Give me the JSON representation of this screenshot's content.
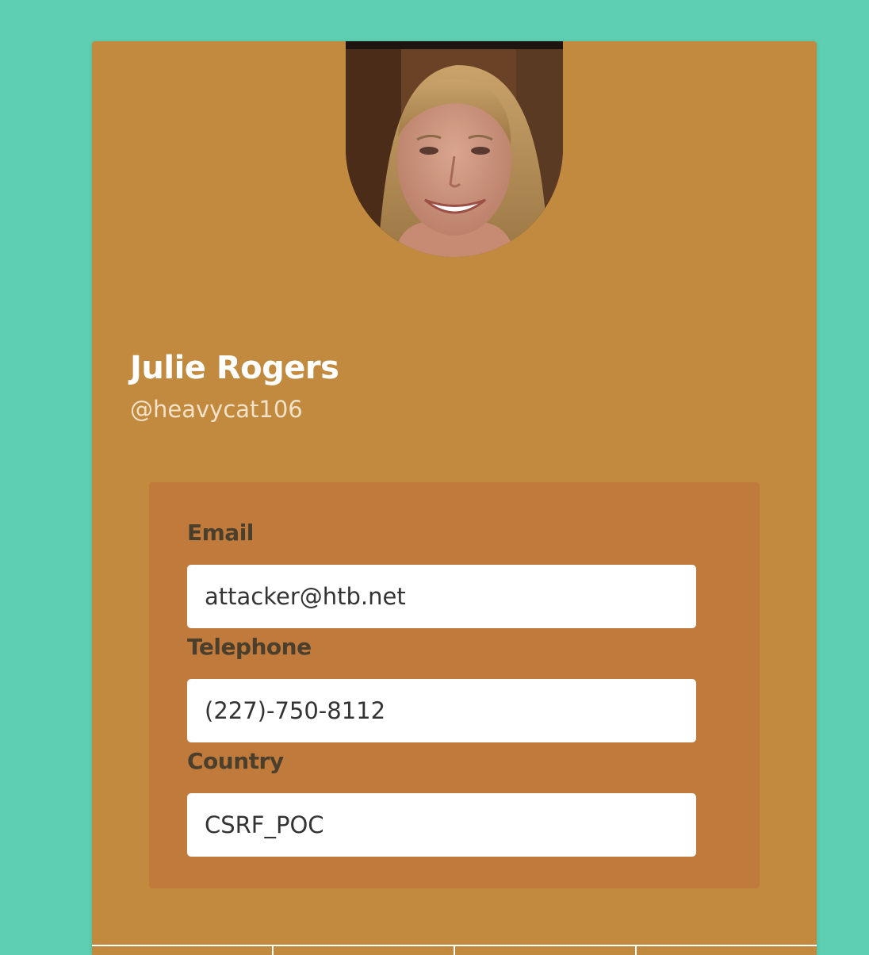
{
  "profile": {
    "name": "Julie Rogers",
    "username": "@heavycat106"
  },
  "fields": {
    "email_label": "Email",
    "email_value": "attacker@htb.net",
    "telephone_label": "Telephone",
    "telephone_value": "(227)-750-8112",
    "country_label": "Country",
    "country_value": "CSRF_POC"
  },
  "colors": {
    "background": "#5ecfb1",
    "card": "#c18a3f",
    "details_panel": "#c07a3b"
  }
}
